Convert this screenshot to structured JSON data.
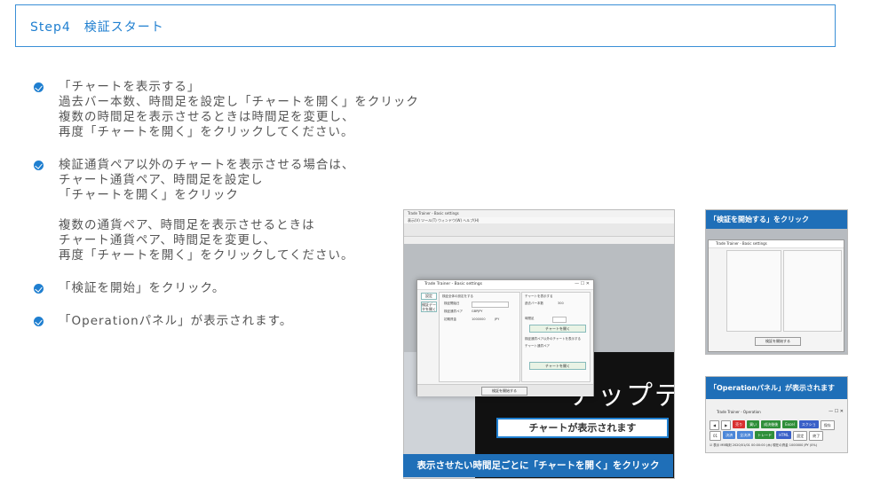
{
  "step": {
    "title": "Step4　検証スタート"
  },
  "bullets": [
    {
      "lines": [
        "「チャートを表示する」",
        "過去バー本数、時間足を設定し「チャートを開く」をクリック",
        "複数の時間足を表示させるときは時間足を変更し、",
        "再度「チャートを開く」をクリックしてください。"
      ]
    },
    {
      "lines": [
        "検証通貨ペア以外のチャートを表示させる場合は、",
        "チャート通貨ペア、時間足を設定し",
        "「チャートを開く」をクリック"
      ],
      "lines2": [
        "複数の通貨ペア、時間足を表示させるときは",
        "チャート通貨ペア、時間足を変更し、",
        "再度「チャートを開く」をクリックしてください。"
      ]
    },
    {
      "lines": [
        "「検証を開始」をクリック。"
      ]
    },
    {
      "lines": [
        "「Operationパネル」が表示されます。"
      ]
    }
  ],
  "main_shot": {
    "window_title": "Trade Trainer - Basic settings",
    "menu": "表示(V)  ツール(T)  ウィンドウ(W)  ヘルプ(H)",
    "dialog_title": "Trade Trainer - Basic settings",
    "dialog_controls": "—  ☐  ✕",
    "left_buttons": [
      "設定",
      "検証データを開く"
    ],
    "labels": [
      "検証全体の設定をする",
      "検証開始日",
      "検証通貨ペア",
      "初期資金",
      "チャートを表示する",
      "過去バー本数",
      "時間足",
      "チャートを開く",
      "検証通貨ペア以外のチャートを表示する",
      "チャート通貨ペア",
      "チャートを開く"
    ],
    "values": [
      "GBPJPY",
      "1000000",
      "JPY",
      "300"
    ],
    "start_button": "検証を開始する",
    "overlay_text": "アップデー",
    "chart_shown": "チャートが表示されます",
    "caption": "表示させたい時間足ごとに「チャートを開く」をクリック"
  },
  "right_top": {
    "caption": "「検証を開始する」をクリック",
    "dialog_title": "Trade Trainer - Basic settings",
    "start_button": "検証を開始する"
  },
  "right_bottom": {
    "caption": "「Operationパネル」が表示されます",
    "window_title": "Trade Trainer - Operation",
    "window_controls": "—  ☐  ✕",
    "row1": [
      "◀",
      "▶",
      "売り",
      "買い",
      "成決後後",
      "Excel",
      "スクショ",
      "保存"
    ],
    "row2": [
      "01",
      "決済",
      "全決済",
      "トレード",
      "HTML",
      "設定",
      "終了"
    ],
    "status": "☑ 表示  M5時刻 2020/01/01 00:00:00 (木)   現在の資金 1000000 JPY (0%)"
  },
  "colors": {
    "accent": "#1f7fd0",
    "caption_bg": "#1f6fb8"
  }
}
